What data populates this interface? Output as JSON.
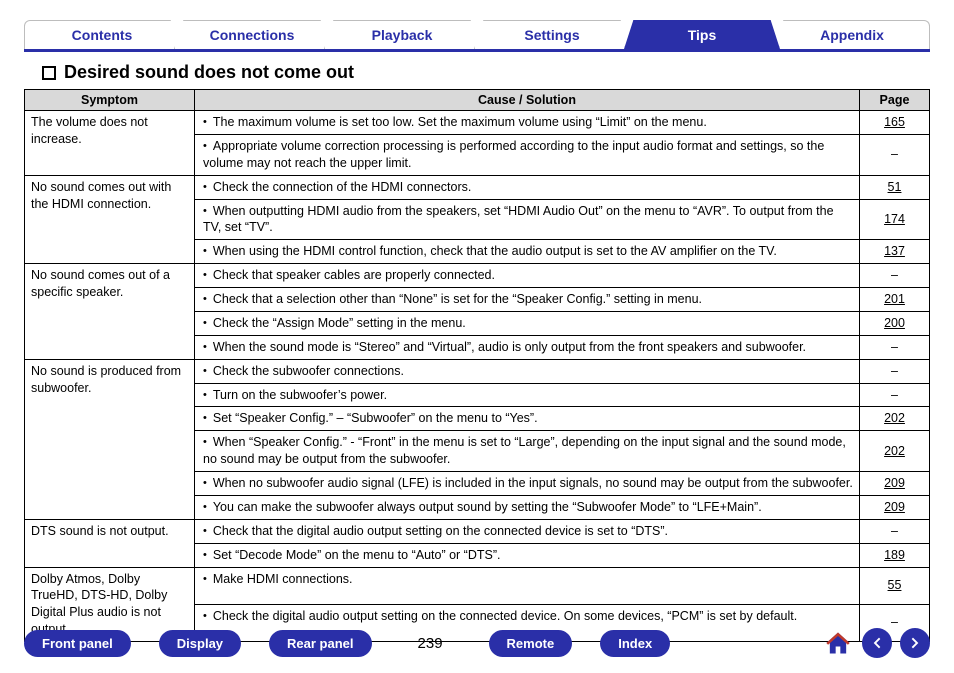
{
  "tabs": [
    {
      "label": "Contents",
      "active": false
    },
    {
      "label": "Connections",
      "active": false
    },
    {
      "label": "Playback",
      "active": false
    },
    {
      "label": "Settings",
      "active": false
    },
    {
      "label": "Tips",
      "active": true
    },
    {
      "label": "Appendix",
      "active": false
    }
  ],
  "heading": "Desired sound does not come out",
  "table": {
    "headers": {
      "symptom": "Symptom",
      "cause": "Cause / Solution",
      "page": "Page"
    },
    "groups": [
      {
        "symptom": "The volume does not increase.",
        "rows": [
          {
            "cause": "The maximum volume is set too low. Set the maximum volume using “Limit” on the menu.",
            "page": "165"
          },
          {
            "cause": "Appropriate volume correction processing is performed according to the input audio format and settings, so the volume may not reach the upper limit.",
            "page": "–"
          }
        ]
      },
      {
        "symptom": "No sound comes out with the HDMI connection.",
        "rows": [
          {
            "cause": "Check the connection of the HDMI connectors.",
            "page": "51"
          },
          {
            "cause": "When outputting HDMI audio from the speakers, set “HDMI Audio Out” on the menu to “AVR”. To output from the TV, set “TV”.",
            "page": "174"
          },
          {
            "cause": "When using the HDMI control function, check that the audio output is set to the AV amplifier on the TV.",
            "page": "137"
          }
        ]
      },
      {
        "symptom": "No sound comes out of a specific speaker.",
        "rows": [
          {
            "cause": "Check that speaker cables are properly connected.",
            "page": "–"
          },
          {
            "cause": "Check that a selection other than “None” is set for the “Speaker Config.” setting in menu.",
            "page": "201"
          },
          {
            "cause": "Check the “Assign Mode” setting in the menu.",
            "page": "200"
          },
          {
            "cause": "When the sound mode is “Stereo” and “Virtual”, audio is only output from the front speakers and subwoofer.",
            "page": "–"
          }
        ]
      },
      {
        "symptom": "No sound is produced from subwoofer.",
        "rows": [
          {
            "cause": "Check the subwoofer connections.",
            "page": "–"
          },
          {
            "cause": "Turn on the subwoofer’s power.",
            "page": "–"
          },
          {
            "cause": "Set “Speaker Config.” – “Subwoofer” on the menu to “Yes”.",
            "page": "202"
          },
          {
            "cause": "When “Speaker Config.” - “Front” in the menu is set to “Large”, depending on the input signal and the sound mode, no sound may be output from the subwoofer.",
            "page": "202"
          },
          {
            "cause": "When no subwoofer audio signal (LFE) is included in the input signals, no sound may be output from the subwoofer.",
            "page": "209"
          },
          {
            "cause": "You can make the subwoofer always output sound by setting the “Subwoofer Mode” to “LFE+Main”.",
            "page": "209"
          }
        ]
      },
      {
        "symptom": "DTS sound is not output.",
        "rows": [
          {
            "cause": "Check that the digital audio output setting on the connected device is set to “DTS”.",
            "page": "–"
          },
          {
            "cause": "Set “Decode Mode” on the menu to “Auto” or “DTS”.",
            "page": "189"
          }
        ]
      },
      {
        "symptom": "Dolby Atmos, Dolby TrueHD, DTS-HD, Dolby Digital Plus audio is not output.",
        "rows": [
          {
            "cause": "Make HDMI connections.",
            "page": "55"
          },
          {
            "cause": "Check the digital audio output setting on the connected device. On some devices, “PCM” is set by default.",
            "page": "–"
          }
        ]
      }
    ]
  },
  "footer": {
    "buttons": [
      "Front panel",
      "Display",
      "Rear panel"
    ],
    "page": "239",
    "buttons2": [
      "Remote",
      "Index"
    ]
  }
}
